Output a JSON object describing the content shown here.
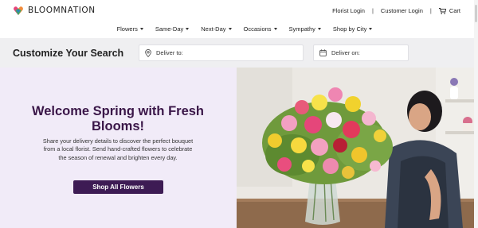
{
  "brand": {
    "name": "BLOOMNATION",
    "colors": {
      "primary": "#3d1b54",
      "heading": "#3a1648",
      "hero_bg": "#f1ebf8"
    }
  },
  "topnav": {
    "florist_login": "Florist Login",
    "separator": "|",
    "customer_login": "Customer Login",
    "cart": "Cart"
  },
  "categories": [
    {
      "label": "Flowers"
    },
    {
      "label": "Same-Day"
    },
    {
      "label": "Next-Day"
    },
    {
      "label": "Occasions"
    },
    {
      "label": "Sympathy"
    },
    {
      "label": "Shop by City"
    }
  ],
  "search": {
    "title": "Customize Your Search",
    "deliver_to_placeholder": "Deliver to:",
    "deliver_on_placeholder": "Deliver on:"
  },
  "hero": {
    "title": "Welcome Spring with Fresh Blooms!",
    "description": "Share your delivery details to discover the perfect bouquet from a local florist. Send hand-crafted flowers to celebrate the season of renewal and brighten every day.",
    "cta": "Shop All Flowers"
  },
  "icons": {
    "logo": "heart-logo-icon",
    "cart": "cart-icon",
    "location": "location-pin-icon",
    "calendar": "calendar-icon",
    "caret": "chevron-down-icon"
  }
}
